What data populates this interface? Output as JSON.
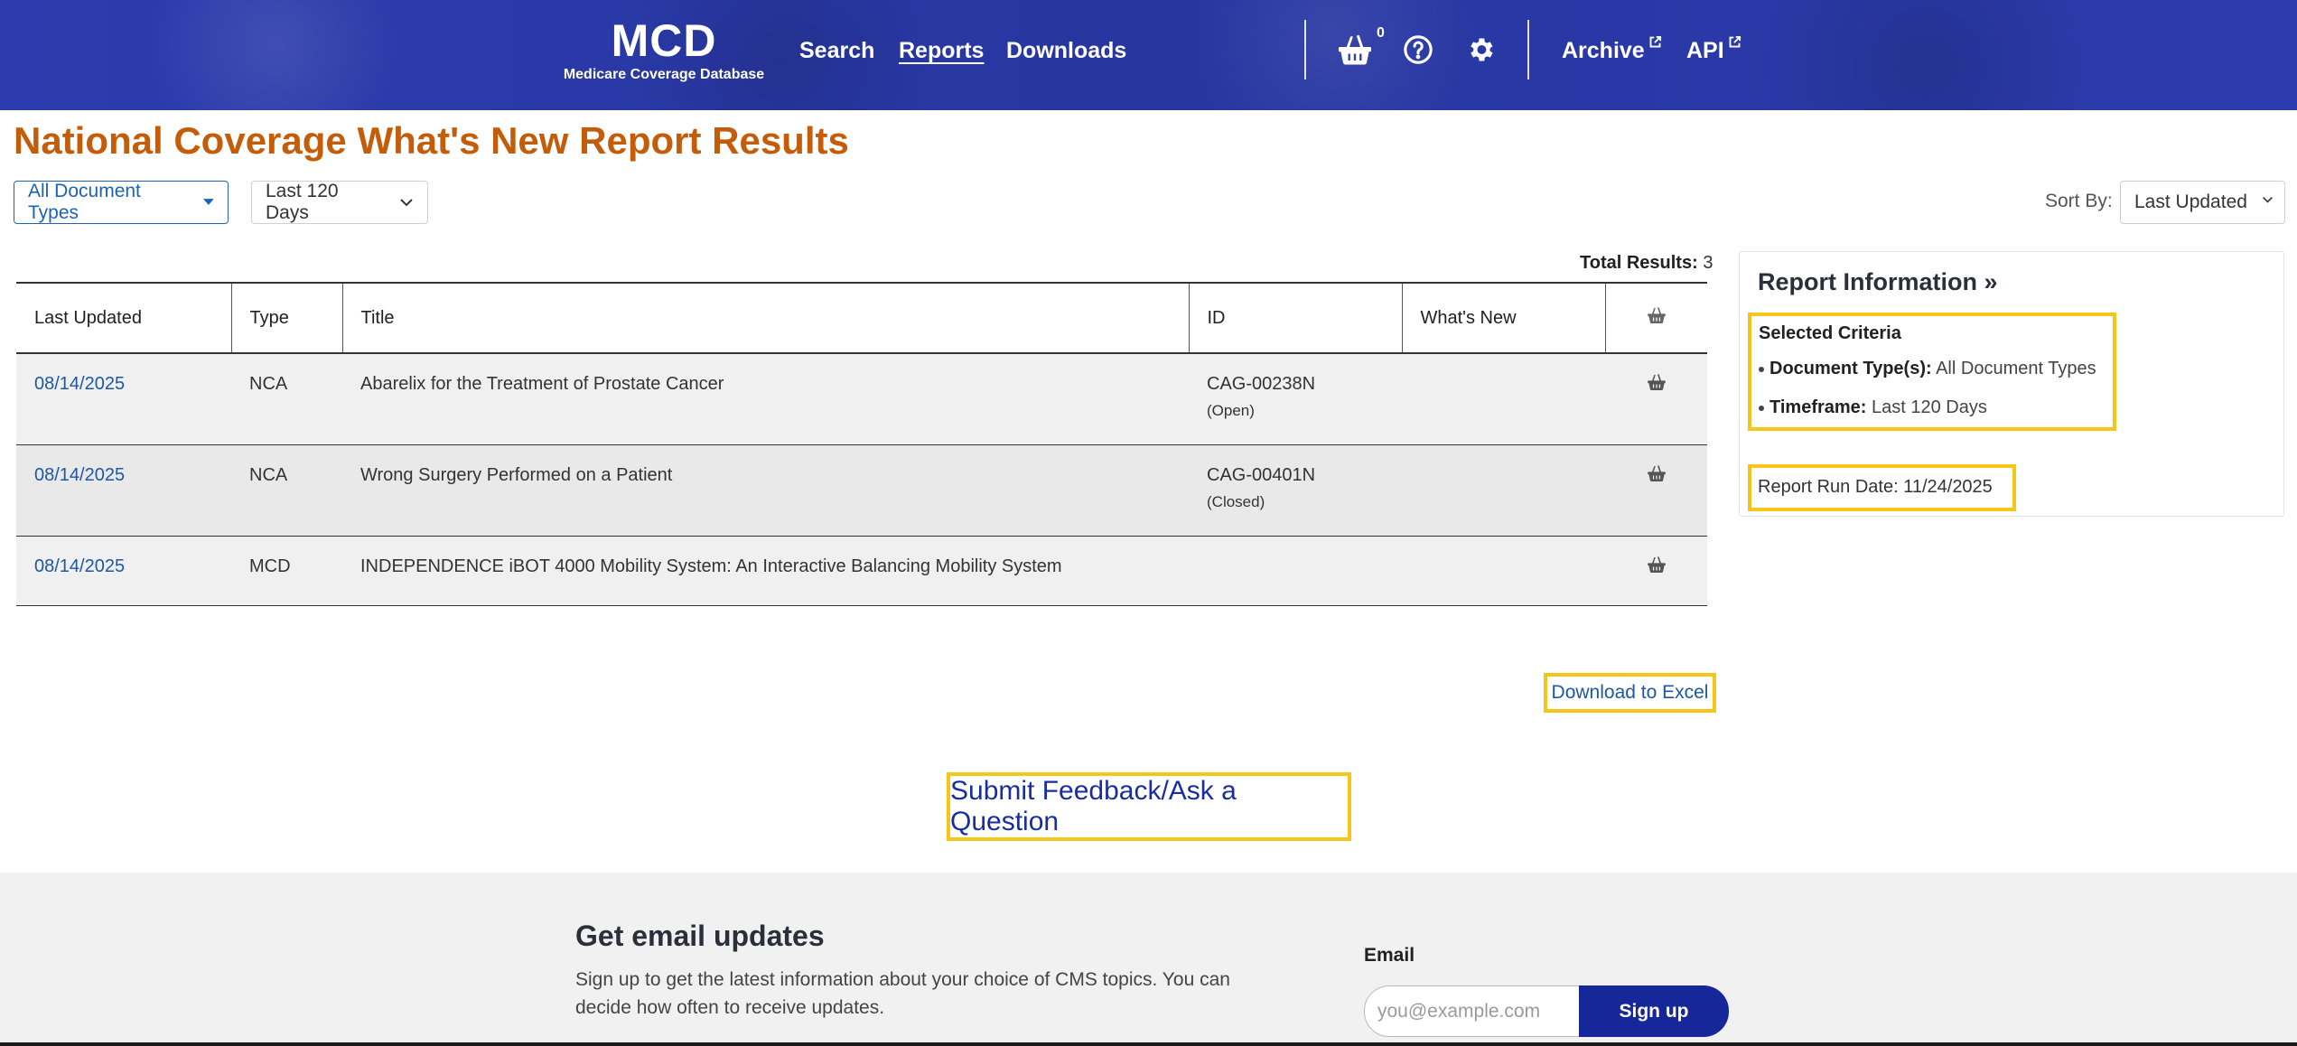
{
  "colors": {
    "header_bg": "#2a3aa8",
    "title_orange": "#c35d0a",
    "link_blue": "#1d57a6",
    "highlight_yellow": "#f5c518",
    "signup_navy": "#16279a"
  },
  "header": {
    "logo_title": "MCD",
    "logo_subtitle": "Medicare Coverage Database",
    "nav": {
      "search": "Search",
      "reports": "Reports",
      "downloads": "Downloads",
      "archive": "Archive",
      "api": "API"
    },
    "active_nav": "Reports",
    "cart_count": "0",
    "icons": [
      "basket-icon",
      "help-icon",
      "gear-icon",
      "external-link-icon"
    ]
  },
  "page": {
    "title": "National Coverage What's New Report Results"
  },
  "filters": {
    "document_types": "All Document Types",
    "timeframe": "Last 120 Days",
    "sort_by_label": "Sort By:",
    "sort_by_value": "Last Updated"
  },
  "results": {
    "total_label": "Total Results:",
    "total_count": "3",
    "columns": [
      "Last Updated",
      "Type",
      "Title",
      "ID",
      "What's New"
    ],
    "rows": [
      {
        "last_updated": "08/14/2025",
        "type": "NCA",
        "title": "Abarelix for the Treatment of Prostate Cancer",
        "id": "CAG-00238N",
        "status": "(Open)",
        "whats_new": ""
      },
      {
        "last_updated": "08/14/2025",
        "type": "NCA",
        "title": "Wrong Surgery Performed on a Patient",
        "id": "CAG-00401N",
        "status": "(Closed)",
        "whats_new": ""
      },
      {
        "last_updated": "08/14/2025",
        "type": "MCD",
        "title": "INDEPENDENCE iBOT 4000 Mobility System: An Interactive Balancing Mobility System",
        "id": "",
        "status": "",
        "whats_new": ""
      }
    ]
  },
  "report_info": {
    "title": "Report Information »",
    "criteria_heading": "Selected Criteria",
    "doc_types_label": "Document Type(s):",
    "doc_types_value": "All Document Types",
    "timeframe_label": "Timeframe:",
    "timeframe_value": "Last 120 Days",
    "run_date": "Report Run Date: 11/24/2025"
  },
  "actions": {
    "download_excel": "Download to Excel",
    "feedback": "Submit Feedback/Ask a Question"
  },
  "footer": {
    "heading": "Get email updates",
    "description": "Sign up to get the latest information about your choice of CMS topics. You can decide how often to receive updates.",
    "email_label": "Email",
    "email_placeholder": "you@example.com",
    "signup_label": "Sign up"
  }
}
